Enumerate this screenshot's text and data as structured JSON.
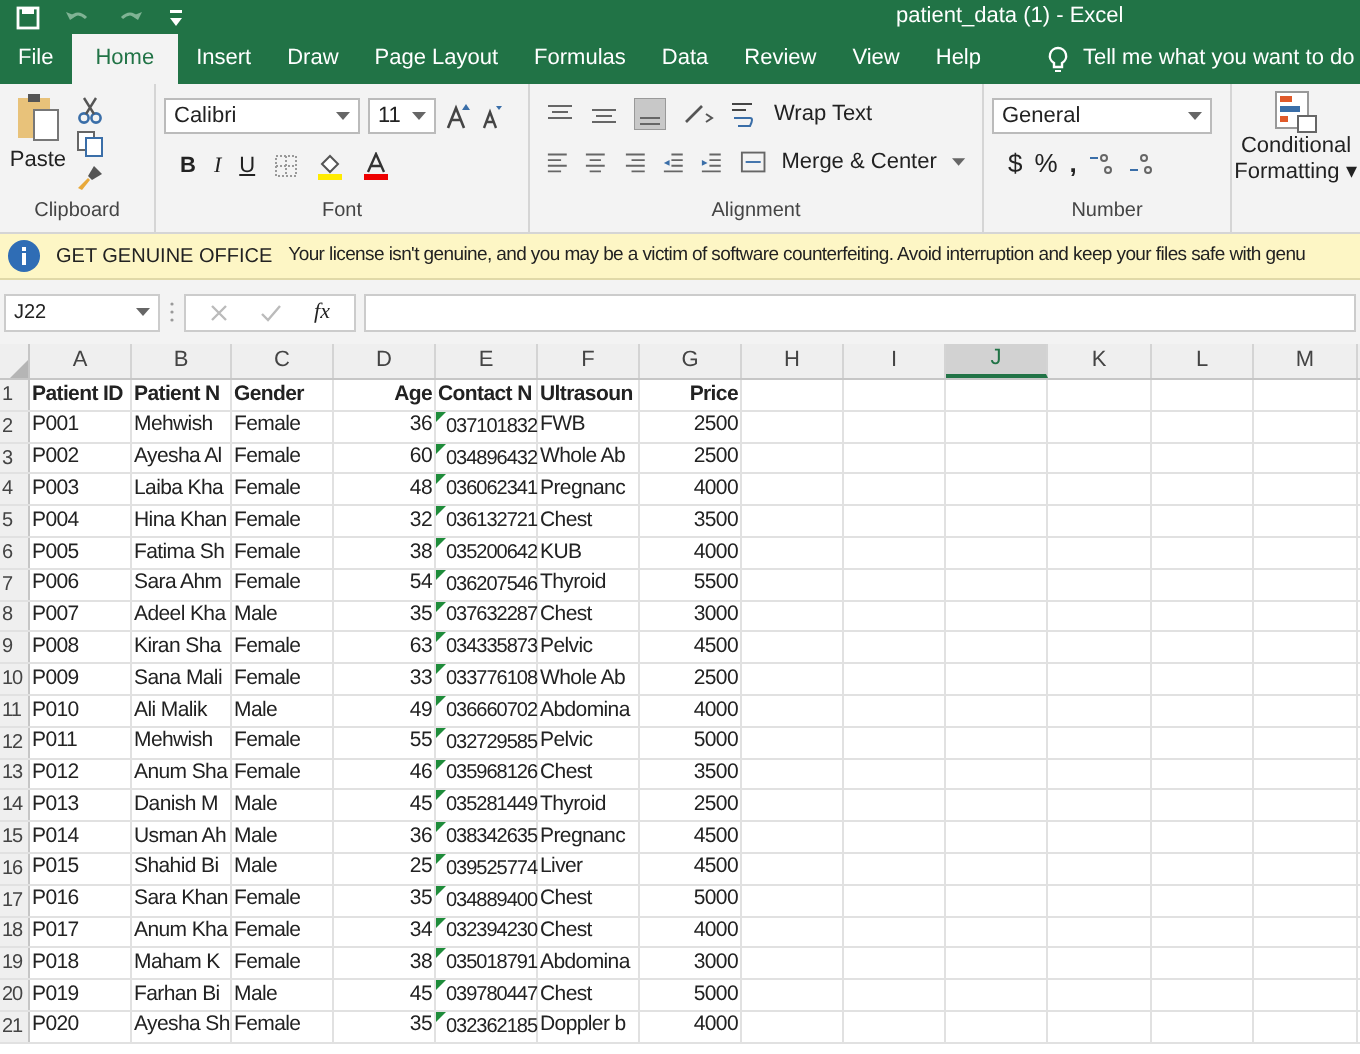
{
  "window": {
    "title": "patient_data (1)  -  Excel"
  },
  "tabs": [
    {
      "label": "File",
      "selected": false
    },
    {
      "label": "Home",
      "selected": true
    },
    {
      "label": "Insert",
      "selected": false
    },
    {
      "label": "Draw",
      "selected": false
    },
    {
      "label": "Page Layout",
      "selected": false
    },
    {
      "label": "Formulas",
      "selected": false
    },
    {
      "label": "Data",
      "selected": false
    },
    {
      "label": "Review",
      "selected": false
    },
    {
      "label": "View",
      "selected": false
    },
    {
      "label": "Help",
      "selected": false
    }
  ],
  "tell_me": "Tell me what you want to do",
  "ribbon": {
    "clipboard": {
      "paste": "Paste",
      "label": "Clipboard"
    },
    "font": {
      "name": "Calibri",
      "size": "11",
      "bold": "B",
      "italic": "I",
      "underline": "U",
      "label": "Font"
    },
    "alignment": {
      "wrap": "Wrap Text",
      "merge": "Merge & Center",
      "label": "Alignment"
    },
    "number": {
      "format": "General",
      "currency": "$",
      "percent": "%",
      "comma": ",",
      "label": "Number"
    },
    "styles": {
      "line1": "Conditional",
      "line2": "Formatting ▾"
    }
  },
  "banner": {
    "title": "GET GENUINE OFFICE",
    "message": "Your license isn't genuine, and you may be a victim of software counterfeiting. Avoid interruption and keep your files safe with genu"
  },
  "formula_bar": {
    "name_box": "J22",
    "fx": "fx"
  },
  "columns": [
    {
      "label": "A",
      "selected": false
    },
    {
      "label": "B",
      "selected": false
    },
    {
      "label": "C",
      "selected": false
    },
    {
      "label": "D",
      "selected": false
    },
    {
      "label": "E",
      "selected": false
    },
    {
      "label": "F",
      "selected": false
    },
    {
      "label": "G",
      "selected": false
    },
    {
      "label": "H",
      "selected": false
    },
    {
      "label": "I",
      "selected": false
    },
    {
      "label": "J",
      "selected": true
    },
    {
      "label": "K",
      "selected": false
    },
    {
      "label": "L",
      "selected": false
    },
    {
      "label": "M",
      "selected": false
    }
  ],
  "header_row": {
    "number": "1",
    "cells": [
      "Patient ID",
      "Patient N",
      "Gender",
      "Age",
      "Contact N",
      "Ultrasoun",
      "Price"
    ]
  },
  "rows": [
    {
      "number": "2",
      "cells": [
        "P001",
        "Mehwish",
        "Female",
        "36",
        "037101832",
        "FWB",
        "2500"
      ],
      "error_flag": true
    },
    {
      "number": "3",
      "cells": [
        "P002",
        "Ayesha Al",
        "Female",
        "60",
        "034896432",
        "Whole Ab",
        "2500"
      ],
      "error_flag": true
    },
    {
      "number": "4",
      "cells": [
        "P003",
        "Laiba Kha",
        "Female",
        "48",
        "036062341",
        "Pregnanc",
        "4000"
      ],
      "error_flag": true
    },
    {
      "number": "5",
      "cells": [
        "P004",
        "Hina Khan",
        "Female",
        "32",
        "036132721",
        "Chest",
        "3500"
      ],
      "error_flag": true
    },
    {
      "number": "6",
      "cells": [
        "P005",
        "Fatima Sh",
        "Female",
        "38",
        "035200642",
        "KUB",
        "4000"
      ],
      "error_flag": true
    },
    {
      "number": "7",
      "cells": [
        "P006",
        "Sara Ahm",
        "Female",
        "54",
        "036207546",
        "Thyroid",
        "5500"
      ],
      "error_flag": true
    },
    {
      "number": "8",
      "cells": [
        "P007",
        "Adeel Kha",
        "Male",
        "35",
        "037632287",
        "Chest",
        "3000"
      ],
      "error_flag": true
    },
    {
      "number": "9",
      "cells": [
        "P008",
        "Kiran Sha",
        "Female",
        "63",
        "034335873",
        "Pelvic",
        "4500"
      ],
      "error_flag": true
    },
    {
      "number": "10",
      "cells": [
        "P009",
        "Sana Mali",
        "Female",
        "33",
        "033776108",
        "Whole Ab",
        "2500"
      ],
      "error_flag": true
    },
    {
      "number": "11",
      "cells": [
        "P010",
        "Ali Malik",
        "Male",
        "49",
        "036660702",
        "Abdomina",
        "4000"
      ],
      "error_flag": true
    },
    {
      "number": "12",
      "cells": [
        "P011",
        "Mehwish",
        "Female",
        "55",
        "032729585",
        "Pelvic",
        "5000"
      ],
      "error_flag": true
    },
    {
      "number": "13",
      "cells": [
        "P012",
        "Anum Sha",
        "Female",
        "46",
        "035968126",
        "Chest",
        "3500"
      ],
      "error_flag": true
    },
    {
      "number": "14",
      "cells": [
        "P013",
        "Danish M",
        "Male",
        "45",
        "035281449",
        "Thyroid",
        "2500"
      ],
      "error_flag": true
    },
    {
      "number": "15",
      "cells": [
        "P014",
        "Usman Ah",
        "Male",
        "36",
        "038342635",
        "Pregnanc",
        "4500"
      ],
      "error_flag": true
    },
    {
      "number": "16",
      "cells": [
        "P015",
        "Shahid Bi",
        "Male",
        "25",
        "039525774",
        "Liver",
        "4500"
      ],
      "error_flag": true
    },
    {
      "number": "17",
      "cells": [
        "P016",
        "Sara Khan",
        "Female",
        "35",
        "034889400",
        "Chest",
        "5000"
      ],
      "error_flag": true
    },
    {
      "number": "18",
      "cells": [
        "P017",
        "Anum Kha",
        "Female",
        "34",
        "032394230",
        "Chest",
        "4000"
      ],
      "error_flag": true
    },
    {
      "number": "19",
      "cells": [
        "P018",
        "Maham K",
        "Female",
        "38",
        "035018791",
        "Abdomina",
        "3000"
      ],
      "error_flag": true
    },
    {
      "number": "20",
      "cells": [
        "P019",
        "Farhan Bi",
        "Male",
        "45",
        "039780447",
        "Chest",
        "5000"
      ],
      "error_flag": true
    },
    {
      "number": "21",
      "cells": [
        "P020",
        "Ayesha Sh",
        "Female",
        "35",
        "032362185",
        "Doppler b",
        "4000"
      ],
      "error_flag": true
    }
  ]
}
